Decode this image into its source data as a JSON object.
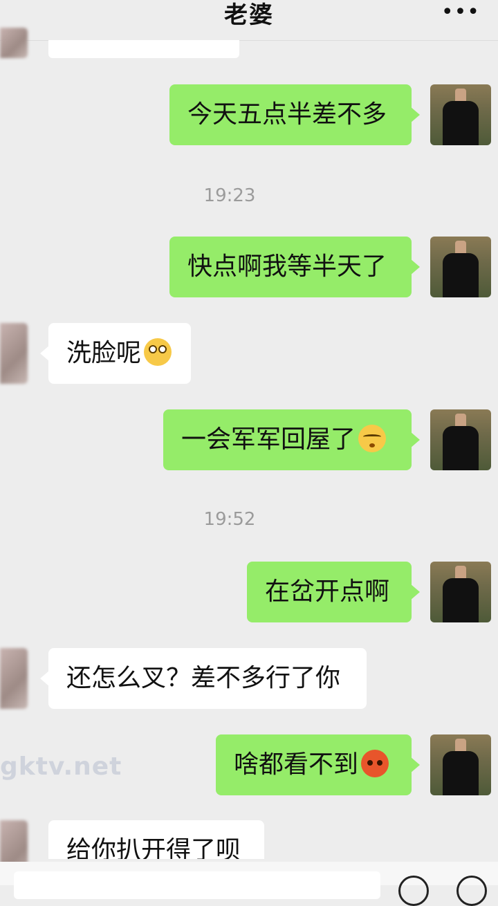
{
  "header": {
    "title": "老婆",
    "more_label": "•••"
  },
  "watermark": "gktv.net",
  "messages": [
    {
      "side": "right",
      "text": "今天五点半差不多"
    },
    {
      "type": "time",
      "text": "19:23"
    },
    {
      "side": "right",
      "text": "快点啊我等半天了"
    },
    {
      "side": "left",
      "text": "洗脸呢",
      "emoji": "wide-eyes-emoji"
    },
    {
      "side": "right",
      "text": "一会军军回屋了",
      "emoji": "sulk-emoji"
    },
    {
      "type": "time",
      "text": "19:52"
    },
    {
      "side": "right",
      "text": "在岔开点啊"
    },
    {
      "side": "left",
      "text": "还怎么叉？差不多行了你"
    },
    {
      "side": "right",
      "text": "啥都看不到",
      "emoji": "angry-emoji"
    },
    {
      "side": "left",
      "text": "给你扒开得了呗"
    }
  ],
  "colors": {
    "background": "#ededed",
    "my_bubble": "#95ec69",
    "their_bubble": "#ffffff"
  }
}
